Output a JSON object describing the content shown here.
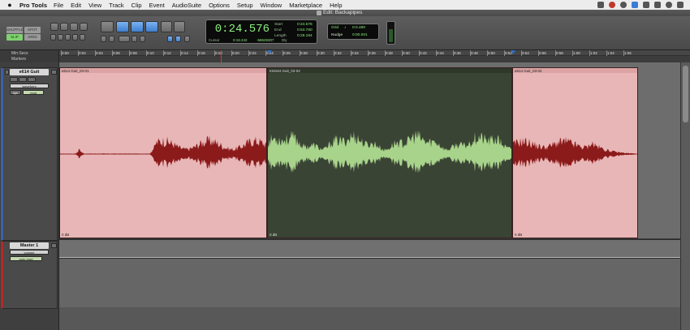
{
  "menubar": {
    "app_name": "Pro Tools",
    "items": [
      "File",
      "Edit",
      "View",
      "Track",
      "Clip",
      "Event",
      "AudioSuite",
      "Options",
      "Setup",
      "Window",
      "Marketplace",
      "Help"
    ]
  },
  "window": {
    "title": "Edit: Backapipes"
  },
  "toolbar": {
    "modes": {
      "shuffle": "SHUFFLE",
      "spot": "SPOT",
      "slip": "SLIP",
      "grid": "GRID",
      "active": "SLIP"
    },
    "counter": {
      "main": "0:24.576",
      "cursor_label": "Cursor",
      "cursor_value": "0:19.242",
      "cursor_sample": "-58629307",
      "dly_label": "Dly",
      "start_label": "Start",
      "start_value": "0:24.576",
      "end_label": "End",
      "end_value": "0:53.760",
      "length_label": "Length",
      "length_value": "0:29.184"
    },
    "grid": {
      "label": "Grid",
      "value": "0:0.480"
    },
    "nudge": {
      "label": "Nudge",
      "value": "0:00.001"
    }
  },
  "ruler": {
    "row_label": "Min:Secs",
    "markers_label": "Markers",
    "ticks": [
      "0:00",
      "0:02",
      "0:04",
      "0:06",
      "0:08",
      "0:10",
      "0:12",
      "0:14",
      "0:16",
      "0:18",
      "0:20",
      "0:22",
      "0:24",
      "0:26",
      "0:28",
      "0:30",
      "0:32",
      "0:34",
      "0:36",
      "0:38",
      "0:40",
      "0:42",
      "0:44",
      "0:46",
      "0:48",
      "0:50",
      "0:52",
      "0:54",
      "0:56",
      "0:58",
      "1:00",
      "1:02",
      "1:04",
      "1:06"
    ]
  },
  "tracks": [
    {
      "name": "e614 Guit",
      "view": "waveform",
      "mode_a": "dyn",
      "mode_b": "read",
      "clips": [
        {
          "name": "e614 Guit_03-01",
          "gain": "0 dB"
        },
        {
          "name": "KM184 Guit_03-02",
          "gain": "0 dB"
        },
        {
          "name": "e614 Guit_03-02",
          "gain": "0 dB"
        }
      ]
    },
    {
      "name": "Master 1",
      "view": "volume",
      "automation": "auto read"
    }
  ],
  "colors": {
    "pink_clip": "#e8b6b6",
    "dark_clip": "#3a4434",
    "wave_red": "#8b1a1a",
    "wave_green": "#a8d38b",
    "counter_green": "#8cf07e"
  }
}
